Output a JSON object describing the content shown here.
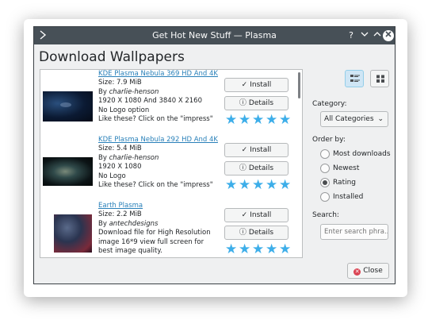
{
  "window": {
    "title": "Get Hot New Stuff — Plasma"
  },
  "heading": "Download Wallpapers",
  "items": [
    {
      "name": "KDE Plasma Nebula 369 HD And 4K",
      "lines": [
        "Size: 7.9 MiB",
        "By",
        "1920 X 1080 And 3840 X 2160",
        " No Logo option",
        " Like these? Click on the \"impress\""
      ],
      "author": "charlie-henson",
      "rating": 5
    },
    {
      "name": "KDE Plasma Nebula 292 HD And 4K",
      "lines": [
        "Size: 5.4 MiB",
        "By",
        "1920 X 1080",
        " No Logo",
        " Like these? Click on the \"impress\""
      ],
      "author": "charlie-henson",
      "rating": 5
    },
    {
      "name": "Earth Plasma",
      "lines": [
        "Size: 2.2 MiB",
        "By",
        "Download file for High Resolution",
        "image 16*9 view full screen for",
        "best image quality."
      ],
      "author": "antechdesigns",
      "rating": 5
    }
  ],
  "buttons": {
    "install": "Install",
    "details": "Details",
    "close": "Close"
  },
  "sidebar": {
    "category_label": "Category:",
    "category_value": "All Categories",
    "order_label": "Order by:",
    "order_options": [
      "Most downloads",
      "Newest",
      "Rating",
      "Installed"
    ],
    "order_selected": "Rating",
    "search_label": "Search:",
    "search_placeholder": "Enter search phra..."
  },
  "icons": {
    "window": "app-menu-icon",
    "help": "help-icon",
    "minimize": "minimize-icon",
    "maximize": "maximize-icon",
    "close": "close-icon",
    "install": "checkmark-icon",
    "details": "info-icon",
    "star": "star-icon",
    "view_list": "list-view-icon",
    "view_grid": "grid-view-icon"
  },
  "colors": {
    "accent": "#3daee9",
    "link": "#2980b9",
    "titlebar": "#475057",
    "close_icon": "#da4453"
  }
}
